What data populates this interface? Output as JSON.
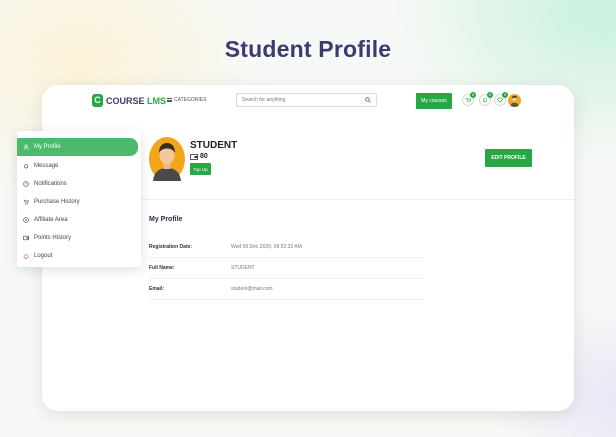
{
  "headline": "Student Profile",
  "brand": {
    "name_part1": "COURSE",
    "name_part2": "LMS"
  },
  "header": {
    "categories_label": "CATEGORIES",
    "search_placeholder": "Search for anything",
    "my_courses_label": "My courses",
    "badges": {
      "cart": "0",
      "notifications": "0",
      "wishlist": "0"
    }
  },
  "profile": {
    "name": "STUDENT",
    "points": "80",
    "topup_label": "Top Up",
    "edit_label": "EDIT PROFILE"
  },
  "sidebar": {
    "items": [
      {
        "label": "My Profile",
        "icon": "user-icon",
        "active": true
      },
      {
        "label": "Message",
        "icon": "bell-icon"
      },
      {
        "label": "Notifications",
        "icon": "clock-icon"
      },
      {
        "label": "Purchase History",
        "icon": "cart-icon"
      },
      {
        "label": "Affiliate Area",
        "icon": "affiliate-icon"
      },
      {
        "label": "Points History",
        "icon": "points-icon"
      },
      {
        "label": "Logout",
        "icon": "power-icon"
      }
    ]
  },
  "section": {
    "title": "My Profile",
    "rows": [
      {
        "label": "Registration Date:",
        "value": "Wed 09 Dec 2020, 09:52:33 AM"
      },
      {
        "label": "Full Name:",
        "value": "STUDENT"
      },
      {
        "label": "Email:",
        "value": "student@mail.com"
      }
    ]
  },
  "colors": {
    "accent": "#28a745",
    "menu_active": "#4cba6c",
    "headline": "#3d3a73"
  }
}
